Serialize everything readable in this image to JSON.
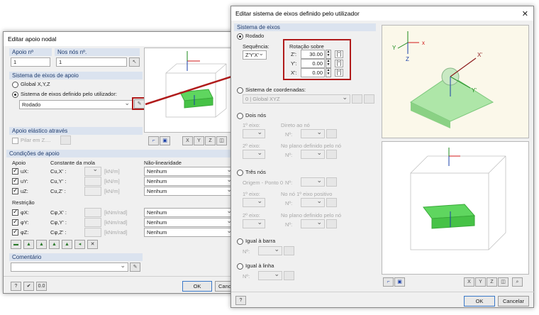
{
  "left": {
    "title": "Editar apoio nodal",
    "support_no_label": "Apoio nº",
    "support_no_value": "1",
    "nodes_label": "Nos nós nº.",
    "nodes_value": "1",
    "axes_section": "Sistema de eixos de apoio",
    "global_xyz": "Global X,Y,Z",
    "user_system": "Sistema de eixos definido pelo utilizador:",
    "user_system_value": "Rodado",
    "elastic_section": "Apoio elástico através",
    "pillar_label": "Pilar em Z....",
    "conditions_section": "Condições de apoio",
    "col_support": "Apoio",
    "col_spring": "Constante da mola",
    "col_nonlin": "Não-linearidade",
    "rows": [
      {
        "sym": "uX:",
        "const": "Cu,X' :",
        "unit": "[kN/m]",
        "nonlin": "Nenhum"
      },
      {
        "sym": "uY:",
        "const": "Cu,Y' :",
        "unit": "[kN/m]",
        "nonlin": "Nenhum"
      },
      {
        "sym": "uZ:",
        "const": "Cu,Z' :",
        "unit": "[kN/m]",
        "nonlin": "Nenhum"
      }
    ],
    "restraint_label": "Restrição",
    "rrows": [
      {
        "sym": "φX:",
        "const": "Cφ,X' :",
        "unit": "[kNm/rad]",
        "nonlin": "Nenhum"
      },
      {
        "sym": "φY:",
        "const": "Cφ,Y' :",
        "unit": "[kNm/rad]",
        "nonlin": "Nenhum"
      },
      {
        "sym": "φZ:",
        "const": "Cφ,Z' :",
        "unit": "[kNm/rad]",
        "nonlin": "Nenhum"
      }
    ],
    "comment_label": "Comentário",
    "ok": "OK",
    "cancel": "Cancelar"
  },
  "right": {
    "title": "Editar sistema de eixos definido pelo utilizador",
    "section": "Sistema de eixos",
    "rotated": "Rodado",
    "sequence_label": "Sequência:",
    "sequence_value": "Z'Y'X'",
    "rotation_label": "Rotação sobre",
    "z_label": "Z':",
    "z_value": "30.00",
    "y_label": "Y':",
    "y_value": "0.00",
    "x_label": "X':",
    "x_value": "0.00",
    "deg_unit": "[°]",
    "coord_system": "Sistema de coordenadas:",
    "coord_value": "0 | Global XYZ",
    "two_nodes": "Dois nós",
    "first_axis": "1º eixo:",
    "direct_to_node": "Direto ao nó",
    "node_no": "Nº:",
    "second_axis": "2º eixo:",
    "plane_def_node": "No plano definido pelo nó",
    "three_nodes": "Três nós",
    "origin": "Origem - Ponto 0",
    "positive_plane": "No nó 1º eixo positivo",
    "equal_member": "Igual à barra",
    "equal_line": "Igual à linha",
    "ok": "OK",
    "cancel": "Cancelar"
  }
}
